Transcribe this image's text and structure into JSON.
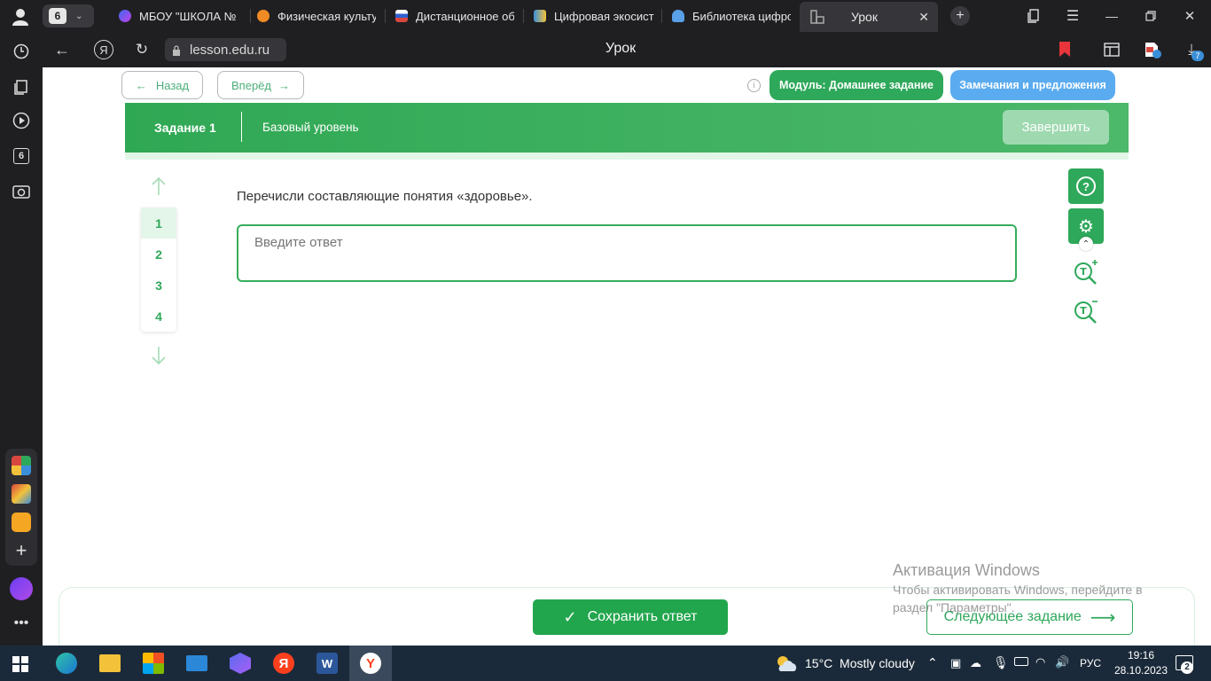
{
  "browser": {
    "tab_counter": "6",
    "tabs": [
      {
        "title": "МБОУ \"ШКОЛА №",
        "icon": "school-favicon",
        "color": "#7b3ff2"
      },
      {
        "title": "Физическая культу",
        "icon": "cloud-favicon",
        "color": "#f08a24"
      },
      {
        "title": "Дистанционное об",
        "icon": "flag-favicon",
        "color": "#d8473f"
      },
      {
        "title": "Цифровая экосист",
        "icon": "map-favicon",
        "color": "#3b8fd9"
      },
      {
        "title": "Библиотека цифро",
        "icon": "book-favicon",
        "color": "#5aa0e6"
      },
      {
        "title": "Урок",
        "icon": "lesson-favicon",
        "color": "#9aa0a6"
      }
    ],
    "address": "lesson.edu.ru",
    "page_title": "Урок",
    "downloads_badge": "7",
    "sidebar_badge": "6"
  },
  "nav": {
    "back_label": "Назад",
    "forward_label": "Вперёд",
    "module_label": "Модуль: Домашнее задание",
    "feedback_label": "Замечания и предложения"
  },
  "task": {
    "number_label": "Задание 1",
    "level_label": "Базовый уровень",
    "finish_label": "Завершить",
    "question": "Перечисли составляющие понятия «здоровье».",
    "answer_placeholder": "Введите ответ",
    "numbers": [
      "1",
      "2",
      "3",
      "4"
    ]
  },
  "footer": {
    "save_label": "Сохранить ответ",
    "next_label": "Следующее задание"
  },
  "watermark": {
    "title": "Активация Windows",
    "line1": "Чтобы активировать Windows, перейдите в",
    "line2": "раздел \"Параметры\"."
  },
  "windows": {
    "weather": "15°C  Mostly cloudy",
    "lang": "РУС",
    "time": "19:16",
    "date": "28.10.2023",
    "notif_count": "2"
  },
  "colors": {
    "green": "#2ea85a",
    "blue_pill": "#5aabf0",
    "tabbar": "#1f1f22"
  }
}
